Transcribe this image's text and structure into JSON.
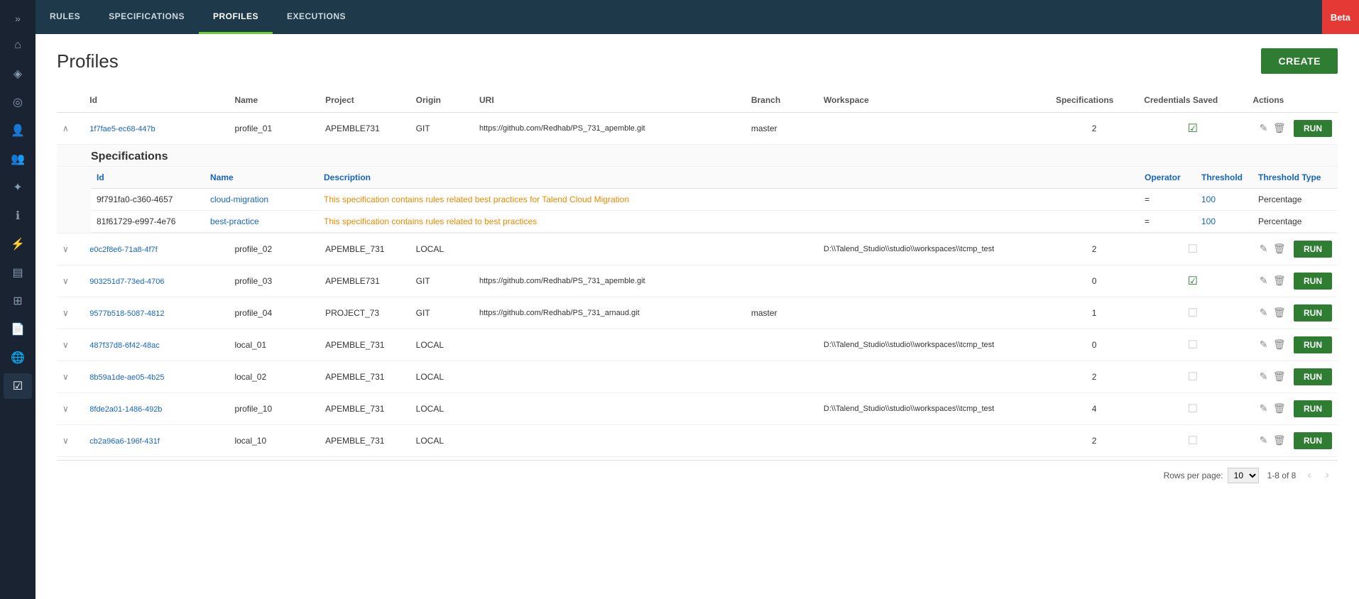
{
  "nav": {
    "items": [
      {
        "id": "rules",
        "label": "RULES",
        "active": false
      },
      {
        "id": "specifications",
        "label": "SPECIFICATIONS",
        "active": false
      },
      {
        "id": "profiles",
        "label": "PROFILES",
        "active": true
      },
      {
        "id": "executions",
        "label": "EXECUTIONS",
        "active": false
      }
    ],
    "beta": "Beta"
  },
  "page": {
    "title": "Profiles",
    "create_button": "CREATE"
  },
  "table": {
    "headers": {
      "id": "Id",
      "name": "Name",
      "project": "Project",
      "origin": "Origin",
      "uri": "URI",
      "branch": "Branch",
      "workspace": "Workspace",
      "specifications": "Specifications",
      "credentials_saved": "Credentials Saved",
      "actions": "Actions"
    },
    "rows": [
      {
        "id": "1f7fae5-ec68-447b",
        "name": "profile_01",
        "project": "APEMBLE731",
        "origin": "GIT",
        "uri": "https://github.com/Redhab/PS_731_apemble.git",
        "branch": "master",
        "workspace": "",
        "specifications": "2",
        "credentials_saved": true,
        "expanded": true,
        "specs": [
          {
            "id": "9f791fa0-c360-4657",
            "name": "cloud-migration",
            "description": "This specification contains rules related best practices for Talend Cloud Migration",
            "operator": "=",
            "threshold": "100",
            "threshold_type": "Percentage"
          },
          {
            "id": "81f61729-e997-4e76",
            "name": "best-practice",
            "description": "This specification contains rules related to best practices",
            "operator": "=",
            "threshold": "100",
            "threshold_type": "Percentage"
          }
        ]
      },
      {
        "id": "e0c2f8e6-71a8-4f7f",
        "name": "profile_02",
        "project": "APEMBLE_731",
        "origin": "LOCAL",
        "uri": "",
        "branch": "",
        "workspace": "D:\\\\Talend_Studio\\\\studio\\\\workspaces\\\\tcmp_test",
        "specifications": "2",
        "credentials_saved": false,
        "expanded": false
      },
      {
        "id": "903251d7-73ed-4706",
        "name": "profile_03",
        "project": "APEMBLE731",
        "origin": "GIT",
        "uri": "https://github.com/Redhab/PS_731_apemble.git",
        "branch": "",
        "workspace": "",
        "specifications": "0",
        "credentials_saved": true,
        "expanded": false
      },
      {
        "id": "9577b518-5087-4812",
        "name": "profile_04",
        "project": "PROJECT_73",
        "origin": "GIT",
        "uri": "https://github.com/Redhab/PS_731_arnaud.git",
        "branch": "master",
        "workspace": "",
        "specifications": "1",
        "credentials_saved": false,
        "expanded": false
      },
      {
        "id": "487f37d8-6f42-48ac",
        "name": "local_01",
        "project": "APEMBLE_731",
        "origin": "LOCAL",
        "uri": "",
        "branch": "",
        "workspace": "D:\\\\Talend_Studio\\\\studio\\\\workspaces\\\\tcmp_test",
        "specifications": "0",
        "credentials_saved": false,
        "expanded": false
      },
      {
        "id": "8b59a1de-ae05-4b25",
        "name": "local_02",
        "project": "APEMBLE_731",
        "origin": "LOCAL",
        "uri": "",
        "branch": "",
        "workspace": "",
        "specifications": "2",
        "credentials_saved": false,
        "expanded": false
      },
      {
        "id": "8fde2a01-1486-492b",
        "name": "profile_10",
        "project": "APEMBLE_731",
        "origin": "LOCAL",
        "uri": "",
        "branch": "",
        "workspace": "D:\\\\Talend_Studio\\\\studio\\\\workspaces\\\\tcmp_test",
        "specifications": "4",
        "credentials_saved": false,
        "expanded": false
      },
      {
        "id": "cb2a96a6-196f-431f",
        "name": "local_10",
        "project": "APEMBLE_731",
        "origin": "LOCAL",
        "uri": "",
        "branch": "",
        "workspace": "",
        "specifications": "2",
        "credentials_saved": false,
        "expanded": false
      }
    ]
  },
  "pagination": {
    "rows_per_page_label": "Rows per page:",
    "rows_per_page": "10",
    "page_info": "1-8 of 8"
  },
  "sidebar": {
    "icons": [
      {
        "name": "expand-icon",
        "symbol": "»"
      },
      {
        "name": "home-icon",
        "symbol": "⌂"
      },
      {
        "name": "tag-icon",
        "symbol": "◈"
      },
      {
        "name": "circle-icon",
        "symbol": "◎"
      },
      {
        "name": "user-icon",
        "symbol": "👤"
      },
      {
        "name": "group-icon",
        "symbol": "👥"
      },
      {
        "name": "tools-icon",
        "symbol": "✦"
      },
      {
        "name": "info-icon",
        "symbol": "ℹ"
      },
      {
        "name": "lightning-icon",
        "symbol": "⚡"
      },
      {
        "name": "layers-icon",
        "symbol": "▤"
      },
      {
        "name": "grid-icon",
        "symbol": "⊞"
      },
      {
        "name": "file-icon",
        "symbol": "📄"
      },
      {
        "name": "globe-icon",
        "symbol": "🌐"
      },
      {
        "name": "checklist-icon",
        "symbol": "☑"
      }
    ]
  }
}
